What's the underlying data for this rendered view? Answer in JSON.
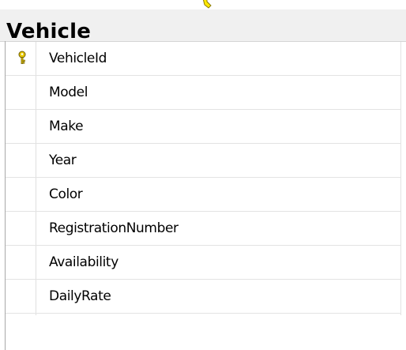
{
  "diagram": {
    "table": {
      "title": "Vehicle",
      "primary_key_icon": "primary-key-icon",
      "columns": [
        {
          "name": "VehicleId",
          "is_primary_key": true
        },
        {
          "name": "Model",
          "is_primary_key": false
        },
        {
          "name": "Make",
          "is_primary_key": false
        },
        {
          "name": "Year",
          "is_primary_key": false
        },
        {
          "name": "Color",
          "is_primary_key": false
        },
        {
          "name": "RegistrationNumber",
          "is_primary_key": false
        },
        {
          "name": "Availability",
          "is_primary_key": false
        },
        {
          "name": "DailyRate",
          "is_primary_key": false
        }
      ]
    },
    "connector_icon": "relationship-connector-icon",
    "colors": {
      "header_background": "#f0f0f0",
      "key_icon": "#e8c800",
      "connector": "#ffe800",
      "row_divider": "#e3e3e3"
    }
  }
}
